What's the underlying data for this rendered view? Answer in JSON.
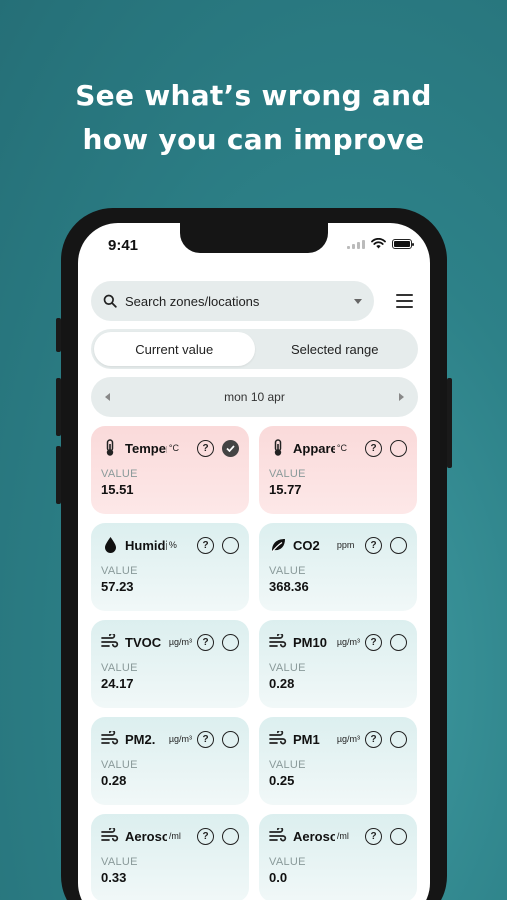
{
  "headline": {
    "line1": "See what’s wrong and",
    "line2": "how you can improve"
  },
  "status_bar": {
    "time": "9:41"
  },
  "search": {
    "placeholder": "Search zones/locations"
  },
  "segmented": {
    "current_value": "Current value",
    "selected_range": "Selected range",
    "active": "current_value"
  },
  "date_nav": {
    "label": "mon 10 apr"
  },
  "cards": [
    {
      "name": "Temper",
      "unit": "°C",
      "label": "VALUE",
      "value": "15.51",
      "icon": "thermometer-icon",
      "selected": true,
      "tone": "red"
    },
    {
      "name": "Appare",
      "unit": "°C",
      "label": "VALUE",
      "value": "15.77",
      "icon": "thermometer-icon",
      "selected": false,
      "tone": "red"
    },
    {
      "name": "Humidity",
      "unit": "%",
      "label": "VALUE",
      "value": "57.23",
      "icon": "droplet-icon",
      "selected": false,
      "tone": "teal"
    },
    {
      "name": "CO2",
      "unit": "ppm",
      "label": "VALUE",
      "value": "368.36",
      "icon": "leaf-icon",
      "selected": false,
      "tone": "teal"
    },
    {
      "name": "TVOC",
      "unit": "µg/m³",
      "label": "VALUE",
      "value": "24.17",
      "icon": "wind-icon",
      "selected": false,
      "tone": "teal"
    },
    {
      "name": "PM10",
      "unit": "µg/m³",
      "label": "VALUE",
      "value": "0.28",
      "icon": "wind-icon",
      "selected": false,
      "tone": "teal"
    },
    {
      "name": "PM2.",
      "unit": "µg/m³",
      "label": "VALUE",
      "value": "0.28",
      "icon": "wind-icon",
      "selected": false,
      "tone": "teal"
    },
    {
      "name": "PM1",
      "unit": "µg/m³",
      "label": "VALUE",
      "value": "0.25",
      "icon": "wind-icon",
      "selected": false,
      "tone": "teal"
    },
    {
      "name": "Aeroso",
      "unit": "/ml",
      "label": "VALUE",
      "value": "0.33",
      "icon": "wind-icon",
      "selected": false,
      "tone": "teal"
    },
    {
      "name": "Aeroso",
      "unit": "/ml",
      "label": "VALUE",
      "value": "0.0",
      "icon": "wind-icon",
      "selected": false,
      "tone": "teal"
    }
  ],
  "colors": {
    "background": "#2d8188",
    "card_alert": "#fadada",
    "card_normal": "#dcefef"
  }
}
